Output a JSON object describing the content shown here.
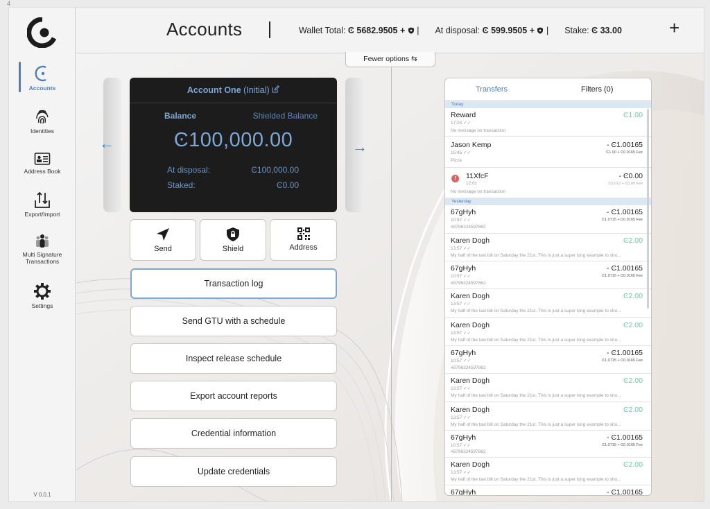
{
  "page_number": "4",
  "sidebar": {
    "items": [
      {
        "label": "Accounts",
        "icon": "accounts-icon",
        "active": true
      },
      {
        "label": "Identities",
        "icon": "fingerprint-icon"
      },
      {
        "label": "Address Book",
        "icon": "address-book-icon"
      },
      {
        "label": "Export/Import",
        "icon": "export-import-icon"
      },
      {
        "label": "Multi Signature Transactions",
        "icon": "multi-signature-icon"
      },
      {
        "label": "Settings",
        "icon": "gear-icon"
      }
    ],
    "version": "V 0.0.1"
  },
  "header": {
    "title": "Accounts",
    "wallet_total_label": "Wallet Total:",
    "wallet_total_value": "Ͼ 5682.9505",
    "at_disposal_label": "At disposal:",
    "at_disposal_value": "Ͼ 599.9505",
    "stake_label": "Stake:",
    "stake_value": "Ͼ 33.00",
    "plus_sep": "+",
    "pipe": "|",
    "add_label": "+"
  },
  "fewer_options": {
    "label": "Fewer options ⇆"
  },
  "account_card": {
    "name": "Account One",
    "subtitle": "(Initial)",
    "balance_tab": "Balance",
    "shielded_tab": "Shielded Balance",
    "amount": "Ͼ100,000.00",
    "at_disposal_label": "At disposal:",
    "at_disposal_value": "Ͼ100,000.00",
    "staked_label": "Staked:",
    "staked_value": "Ͼ0.00"
  },
  "actions": [
    {
      "label": "Send",
      "icon": "send-icon"
    },
    {
      "label": "Shield",
      "icon": "shield-icon"
    },
    {
      "label": "Address",
      "icon": "qr-code-icon"
    }
  ],
  "menu_buttons": [
    "Transaction log",
    "Send GTU with a schedule",
    "Inspect release schedule",
    "Export account reports",
    "Credential information",
    "Update credentials"
  ],
  "transfers": {
    "tab_transfers": "Transfers",
    "tab_filters": "Filters (0)",
    "day_today": "Today",
    "day_yesterday": "Yesterday",
    "items": [
      {
        "name": "Reward",
        "time": "17:24 ✓✓",
        "memo": "No message on transaction",
        "amount": "Ͼ1.00",
        "fee": ""
      },
      {
        "name": "Jason Kemp",
        "time": "15:45 ✓✓",
        "memo": "Pizza",
        "amount": "- Ͼ1.00165",
        "fee": "Ͼ1.00 + Ͼ0.0165 Fee"
      },
      {
        "name": "11XfcF",
        "time": "12:01",
        "memo": "No message on transaction",
        "amount": "- Ͼ0.00",
        "fee": "Ͼ0.012 + Ͼ0.00 Fee"
      },
      {
        "name": "67gHyh",
        "time": "10:57 ✓✓",
        "memo": "#8796324597862",
        "amount": "- Ͼ1.00165",
        "fee": "Ͼ1.0715 + Ͼ0.0165 Fee"
      },
      {
        "name": "Karen Dogh",
        "time": "13:57 ✓✓",
        "memo": "My half of the taxi bill on Saturday the 21st. This is just a super long example to sho...",
        "amount": "Ͼ2.00",
        "fee": ""
      },
      {
        "name": "67gHyh",
        "time": "10:57 ✓✓",
        "memo": "#8796324597862",
        "amount": "- Ͼ1.00165",
        "fee": "Ͼ1.0715 + Ͼ0.0165 Fee"
      },
      {
        "name": "Karen Dogh",
        "time": "13:57 ✓✓",
        "memo": "My half of the taxi bill on Saturday the 21st. This is just a super long example to sho...",
        "amount": "Ͼ2.00",
        "fee": ""
      },
      {
        "name": "Karen Dogh",
        "time": "13:57 ✓✓",
        "memo": "My half of the taxi bill on Saturday the 21st. This is just a super long example to sho...",
        "amount": "Ͼ2.00",
        "fee": ""
      },
      {
        "name": "67gHyh",
        "time": "10:57 ✓✓",
        "memo": "#8796324597862",
        "amount": "- Ͼ1.00165",
        "fee": "Ͼ1.0715 + Ͼ0.0165 Fee"
      },
      {
        "name": "Karen Dogh",
        "time": "13:57 ✓✓",
        "memo": "My half of the taxi bill on Saturday the 21st. This is just a super long example to sho...",
        "amount": "Ͼ2.00",
        "fee": ""
      },
      {
        "name": "Karen Dogh",
        "time": "13:57 ✓✓",
        "memo": "My half of the taxi bill on Saturday the 21st. This is just a super long example to sho...",
        "amount": "Ͼ2.00",
        "fee": ""
      },
      {
        "name": "67gHyh",
        "time": "10:57 ✓✓",
        "memo": "#8796324597862",
        "amount": "- Ͼ1.00165",
        "fee": "Ͼ1.0715 + Ͼ0.0165 Fee"
      },
      {
        "name": "Karen Dogh",
        "time": "13:57 ✓✓",
        "memo": "My half of the taxi bill on Saturday the 21st. This is just a super long example to sho...",
        "amount": "Ͼ2.00",
        "fee": ""
      },
      {
        "name": "67gHyh",
        "time": "",
        "memo": "",
        "amount": "- Ͼ1.00165",
        "fee": ""
      }
    ]
  },
  "colors": {
    "accent": "#4b7fb5",
    "card_bg": "#1c1c1c",
    "positive": "#6bc9a3",
    "warning": "#e05f5f"
  }
}
